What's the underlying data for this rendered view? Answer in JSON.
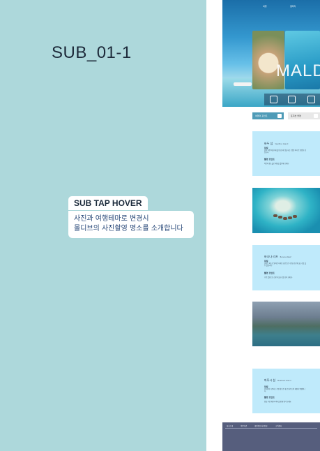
{
  "left": {
    "title": "SUB_01-1",
    "hover_label": "SUB TAP HOVER",
    "hover_desc": "사진과 여행테마로 변경시\n몰디브의 사진촬영 명소를 소개합니다"
  },
  "hero": {
    "nav": [
      "여행",
      "갤러리"
    ],
    "headline": "MALD",
    "bar_items": [
      "",
      "",
      ""
    ]
  },
  "tabs": {
    "active_label": "여행의 포인트",
    "inactive_label": "포지션 촬영"
  },
  "cards": [
    {
      "title": "바두 섬",
      "subtitle": "Vaadhoo Island",
      "head1": "특징",
      "body1": "밤이 되면 바닷가에 플랑크톤이 빛을 내는 '별빛 바다'로 유명한 섬입니다.",
      "head2": "촬영 포인트",
      "body2": "야간에 장노출로 해변을 촬영해 보세요."
    },
    {
      "title": "바나나 리프",
      "subtitle": "Banana Reef",
      "head1": "특징",
      "body1": "몰디브 최초로 알려진 다이빙 포인트로 다양한 산호와 물고기를 볼 수 있습니다.",
      "head2": "촬영 포인트",
      "body2": "수중 촬영으로 산호와 물고기를 담아 보세요."
    },
    {
      "title": "마푸시 섬",
      "subtitle": "Maafushi Island",
      "head1": "특징",
      "body1": "현지인이 거주하는 로컬 섬으로 게스트하우스와 해변이 유명합니다.",
      "head2": "촬영 포인트",
      "body2": "일몰 무렵 해변과 바다를 함께 담아 보세요."
    }
  ],
  "footer": {
    "links": [
      "회사소개",
      "이용약관",
      "개인정보처리방침",
      "고객센터"
    ],
    "info": [
      "",
      "",
      ""
    ]
  },
  "colors": {
    "left_bg": "#add8db",
    "card_bg": "#bfeafb",
    "footer_bg": "#565e7d",
    "tab_active": "#4f9bb7"
  }
}
